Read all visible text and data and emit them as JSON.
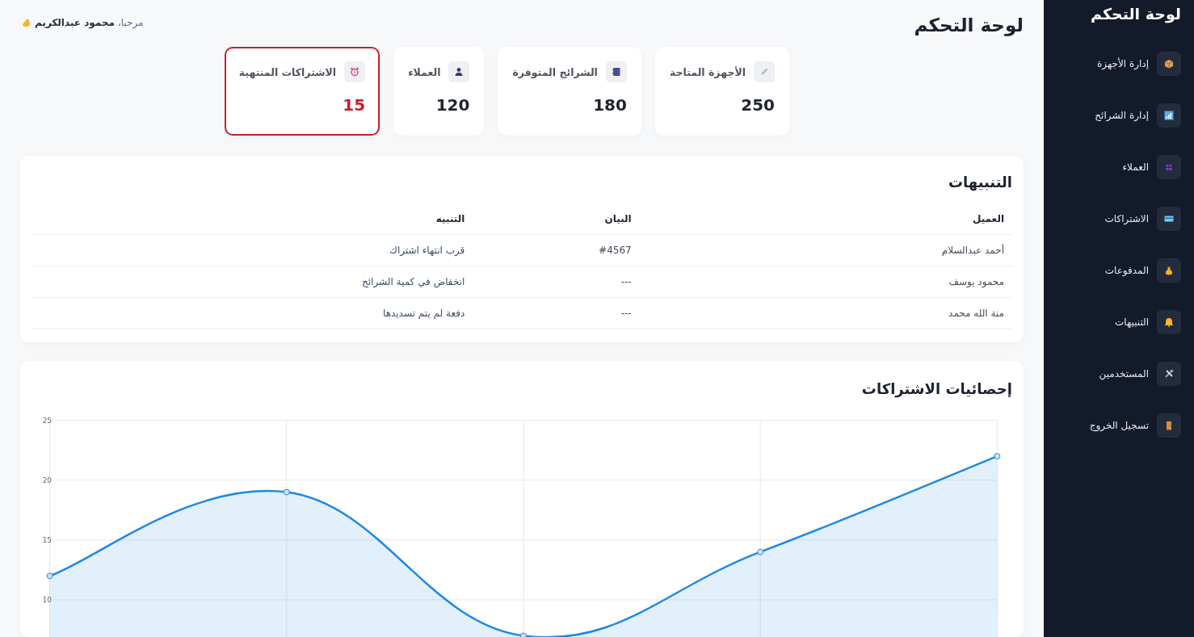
{
  "sidebar": {
    "title": "لوحة التحكم",
    "items": [
      {
        "label": "إدارة الأجهزة"
      },
      {
        "label": "إدارة الشرائح"
      },
      {
        "label": "العملاء"
      },
      {
        "label": "الاشتراكات"
      },
      {
        "label": "المدفوعات"
      },
      {
        "label": "التنبيهات"
      },
      {
        "label": "المستخدمين"
      },
      {
        "label": "تسجيل الخروج"
      }
    ]
  },
  "header": {
    "title": "لوحة التحكم",
    "greeting": "مرحبا، **محمود عبدالكريم**"
  },
  "stats": [
    {
      "label": "الأجهزة المتاحة",
      "value": "250",
      "alert": false
    },
    {
      "label": "الشرائح المتوفرة",
      "value": "180",
      "alert": false
    },
    {
      "label": "العملاء",
      "value": "120",
      "alert": false
    },
    {
      "label": "الاشتراكات المنتهية",
      "value": "15",
      "alert": true
    }
  ],
  "alerts": {
    "title": "التنبيهات",
    "columns": [
      "العميل",
      "البيان",
      "التنبيه"
    ],
    "rows": [
      [
        "أحمد عبدالسلام",
        "#4567",
        "قرب انتهاء اشتراك"
      ],
      [
        "محمود يوسف",
        "---",
        "انخفاض في كمية الشرائح"
      ],
      [
        "منة الله محمد",
        "---",
        "دفعة لم يتم تسديدها"
      ]
    ]
  },
  "stats_chart": {
    "title": "إحصائيات الاشتراكات",
    "chart_data": {
      "type": "area",
      "ylim": [
        6,
        25
      ],
      "yticks": [
        10,
        15,
        20,
        25
      ],
      "grid": true,
      "series": [
        {
          "color": "#1e88e5",
          "values": [
            12,
            19,
            7,
            14,
            22
          ]
        }
      ]
    }
  }
}
